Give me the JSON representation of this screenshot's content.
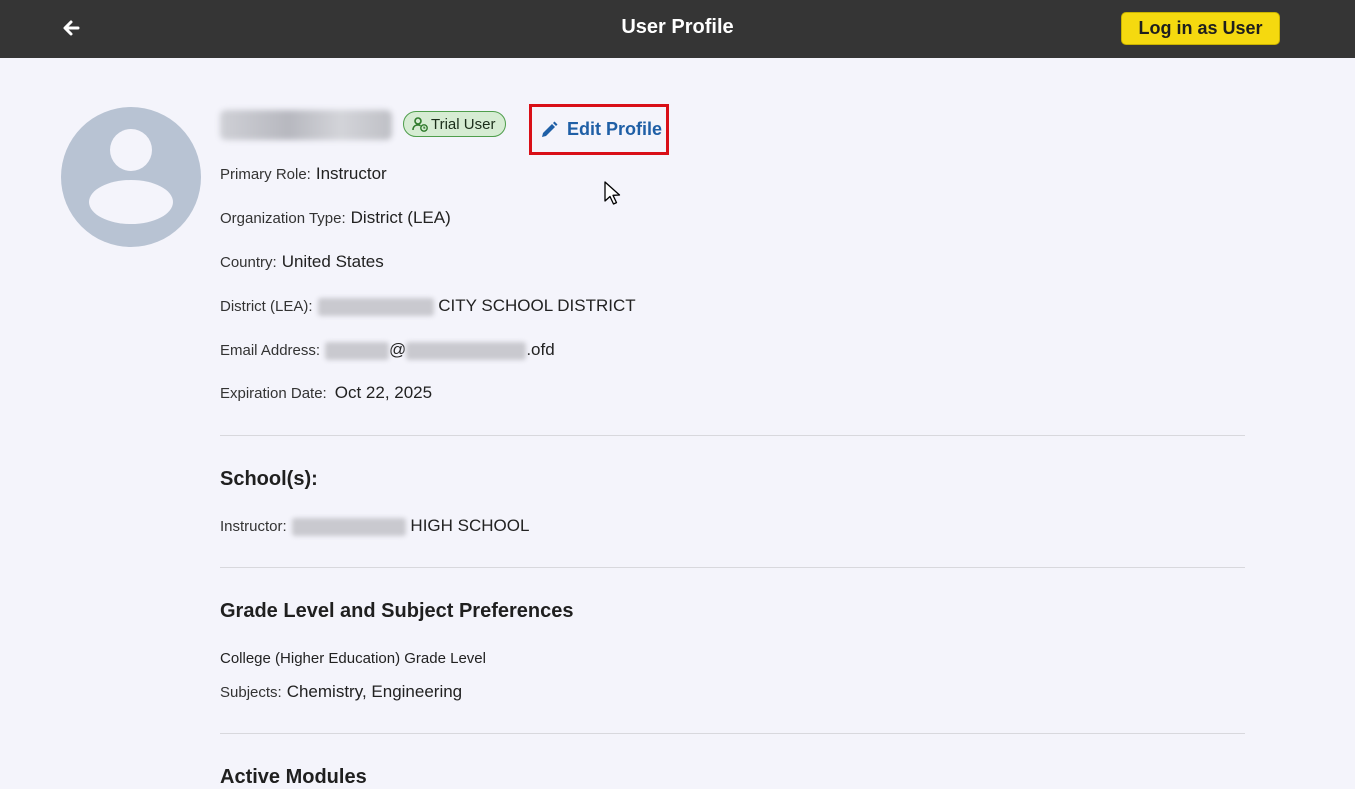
{
  "header": {
    "title": "User Profile",
    "login_button": "Log in as User",
    "back_icon": "arrow-left-icon"
  },
  "profile": {
    "badge": "Trial User",
    "edit_label": "Edit Profile",
    "fields": {
      "primary_role": {
        "label": "Primary Role:",
        "value": "Instructor"
      },
      "org_type": {
        "label": "Organization Type:",
        "value": "District (LEA)"
      },
      "country": {
        "label": "Country:",
        "value": "United States"
      },
      "district": {
        "label": "District (LEA):",
        "value": "CITY SCHOOL DISTRICT"
      },
      "email": {
        "label": "Email Address:",
        "at": "@",
        "suffix": ".ofd"
      },
      "expiration": {
        "label": "Expiration Date:",
        "value": "Oct 22, 2025"
      }
    }
  },
  "schools": {
    "heading": "School(s):",
    "instructor_label": "Instructor:",
    "instructor_value": "HIGH SCHOOL"
  },
  "preferences": {
    "heading": "Grade Level and Subject Preferences",
    "grade_level": "College (Higher Education) Grade Level",
    "subjects_label": "Subjects:",
    "subjects_value": "Chemistry, Engineering"
  },
  "modules": {
    "heading": "Active Modules"
  },
  "colors": {
    "topbar": "#353535",
    "login_button": "#f5d90f",
    "highlight_box": "#d90f17",
    "link": "#1f5fa6",
    "badge_bg": "#d6ecd3"
  }
}
